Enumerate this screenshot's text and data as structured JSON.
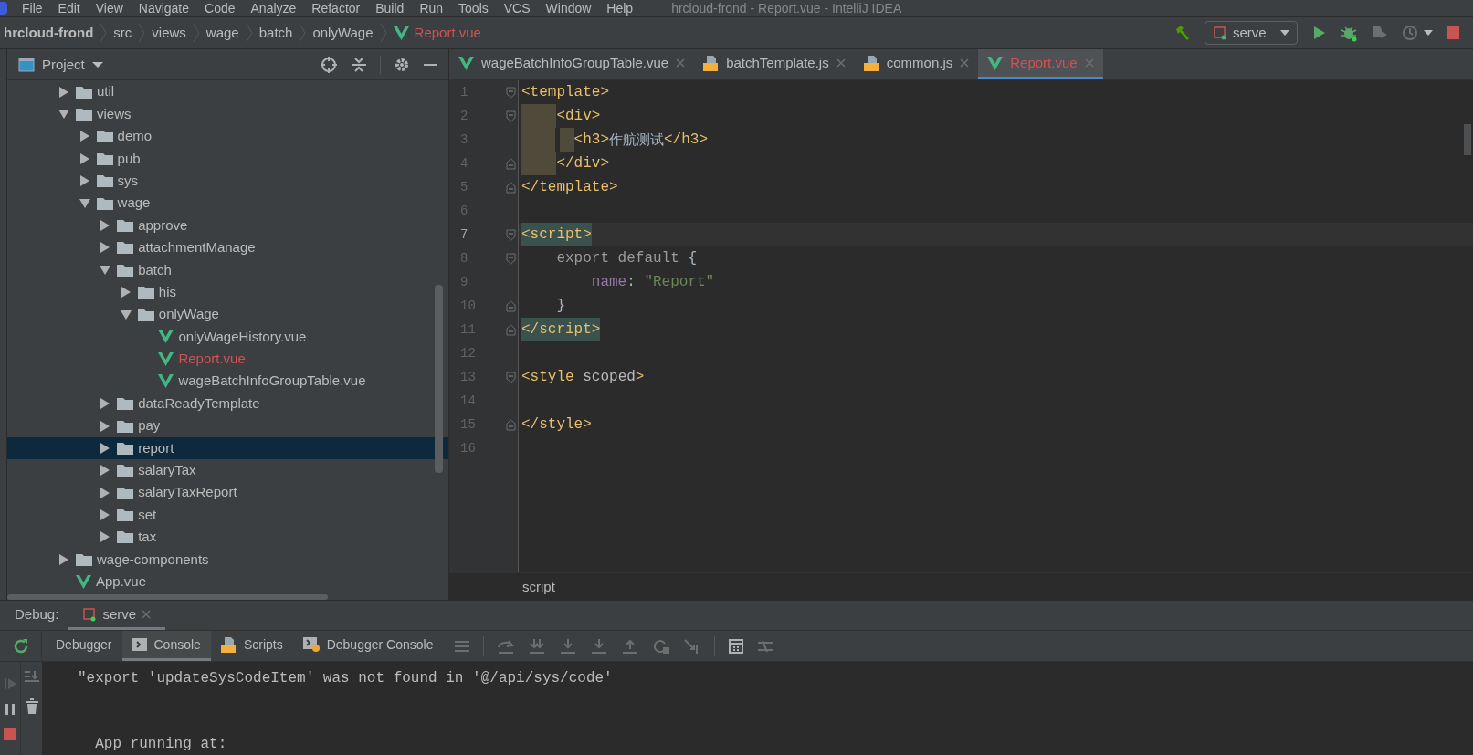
{
  "menu": [
    "File",
    "Edit",
    "View",
    "Navigate",
    "Code",
    "Analyze",
    "Refactor",
    "Build",
    "Run",
    "Tools",
    "VCS",
    "Window",
    "Help"
  ],
  "window": {
    "title": "hrcloud-frond - Report.vue - IntelliJ IDEA"
  },
  "breadcrumbs": [
    {
      "label": "hrcloud-frond",
      "kind": "project"
    },
    {
      "label": "src",
      "kind": "folder"
    },
    {
      "label": "views",
      "kind": "folder"
    },
    {
      "label": "wage",
      "kind": "folder"
    },
    {
      "label": "batch",
      "kind": "folder"
    },
    {
      "label": "onlyWage",
      "kind": "folder"
    },
    {
      "label": "Report.vue",
      "kind": "vue",
      "color": "#d25252"
    }
  ],
  "run_config": {
    "label": "serve"
  },
  "project_panel": {
    "title": "Project"
  },
  "tree": [
    {
      "label": "util",
      "kind": "folder",
      "expanded": false,
      "selected": false
    },
    {
      "label": "views",
      "kind": "folder",
      "expanded": true,
      "selected": false,
      "children": [
        {
          "label": "demo",
          "kind": "folder",
          "expanded": false,
          "selected": false
        },
        {
          "label": "pub",
          "kind": "folder",
          "expanded": false,
          "selected": false
        },
        {
          "label": "sys",
          "kind": "folder",
          "expanded": false,
          "selected": false
        },
        {
          "label": "wage",
          "kind": "folder",
          "expanded": true,
          "selected": false,
          "children": [
            {
              "label": "approve",
              "kind": "folder",
              "expanded": false,
              "selected": false
            },
            {
              "label": "attachmentManage",
              "kind": "folder",
              "expanded": false,
              "selected": false
            },
            {
              "label": "batch",
              "kind": "folder",
              "expanded": true,
              "selected": false,
              "children": [
                {
                  "label": "his",
                  "kind": "folder",
                  "expanded": false,
                  "selected": false
                },
                {
                  "label": "onlyWage",
                  "kind": "folder",
                  "expanded": true,
                  "selected": false,
                  "children": [
                    {
                      "label": "onlyWageHistory.vue",
                      "kind": "vue",
                      "selected": false
                    },
                    {
                      "label": "Report.vue",
                      "kind": "vue",
                      "selected": false,
                      "color": "#d25252"
                    },
                    {
                      "label": "wageBatchInfoGroupTable.vue",
                      "kind": "vue",
                      "selected": false
                    }
                  ]
                }
              ]
            },
            {
              "label": "dataReadyTemplate",
              "kind": "folder",
              "expanded": false,
              "selected": false
            },
            {
              "label": "pay",
              "kind": "folder",
              "expanded": false,
              "selected": false
            },
            {
              "label": "report",
              "kind": "folder",
              "expanded": false,
              "selected": true
            },
            {
              "label": "salaryTax",
              "kind": "folder",
              "expanded": false,
              "selected": false
            },
            {
              "label": "salaryTaxReport",
              "kind": "folder",
              "expanded": false,
              "selected": false
            },
            {
              "label": "set",
              "kind": "folder",
              "expanded": false,
              "selected": false
            },
            {
              "label": "tax",
              "kind": "folder",
              "expanded": false,
              "selected": false
            }
          ]
        }
      ]
    },
    {
      "label": "wage-components",
      "kind": "folder",
      "expanded": false,
      "selected": false
    },
    {
      "label": "App.vue",
      "kind": "vue",
      "selected": false
    }
  ],
  "editor_tabs": [
    {
      "label": "wageBatchInfoGroupTable.vue",
      "kind": "vue",
      "selected": false
    },
    {
      "label": "batchTemplate.js",
      "kind": "js",
      "selected": false
    },
    {
      "label": "common.js",
      "kind": "js",
      "selected": false
    },
    {
      "label": "Report.vue",
      "kind": "vue",
      "selected": true,
      "color": "#d25252"
    }
  ],
  "code_lines": [
    {
      "number": "1",
      "fold_start": true,
      "fold_end": false,
      "tokens": [
        {
          "kind": "tag",
          "text": "<template>"
        }
      ]
    },
    {
      "number": "2",
      "fold_start": true,
      "fold_end": false,
      "indent_guide": true,
      "tokens": [
        {
          "kind": "tag",
          "text": "    <div>"
        }
      ]
    },
    {
      "number": "3",
      "fold_start": false,
      "fold_end": false,
      "indent_guide": true,
      "tokens": [
        {
          "kind": "tag",
          "text": "      <h3>"
        },
        {
          "kind": "text",
          "text": "作航测试"
        },
        {
          "kind": "tag",
          "text": "</h3>"
        }
      ]
    },
    {
      "number": "4",
      "fold_start": false,
      "fold_end": true,
      "indent_guide": true,
      "tokens": [
        {
          "kind": "tag",
          "text": "    </div>"
        }
      ]
    },
    {
      "number": "5",
      "fold_start": false,
      "fold_end": true,
      "tokens": [
        {
          "kind": "tag",
          "text": "</template>"
        }
      ]
    },
    {
      "number": "6",
      "fold_start": false,
      "fold_end": false
    },
    {
      "number": "7",
      "fold_start": true,
      "fold_end": false,
      "current": true,
      "tokens": [
        {
          "kind": "tag-match",
          "text": "<script>"
        }
      ]
    },
    {
      "number": "8",
      "fold_start": true,
      "fold_end": false,
      "tokens": [
        {
          "kind": "keyword",
          "text": "    export default "
        },
        {
          "kind": "text",
          "text": "{"
        }
      ]
    },
    {
      "number": "9",
      "fold_start": false,
      "fold_end": false,
      "tokens": [
        {
          "kind": "property",
          "text": "        name"
        },
        {
          "kind": "text",
          "text": ": "
        },
        {
          "kind": "string",
          "text": "\"Report\""
        }
      ]
    },
    {
      "number": "10",
      "fold_start": false,
      "fold_end": true,
      "tokens": [
        {
          "kind": "text",
          "text": "    }"
        }
      ]
    },
    {
      "number": "11",
      "fold_start": false,
      "fold_end": true,
      "tokens": [
        {
          "kind": "tag-match",
          "text": "</script>"
        }
      ]
    },
    {
      "number": "12",
      "fold_start": false,
      "fold_end": false
    },
    {
      "number": "13",
      "fold_start": true,
      "fold_end": false,
      "tokens": [
        {
          "kind": "tag",
          "text": "<style "
        },
        {
          "kind": "attr",
          "text": "scoped"
        },
        {
          "kind": "tag",
          "text": ">"
        }
      ]
    },
    {
      "number": "14",
      "fold_start": false,
      "fold_end": false
    },
    {
      "number": "15",
      "fold_start": false,
      "fold_end": true,
      "tokens": [
        {
          "kind": "tag",
          "text": "</style>"
        }
      ]
    },
    {
      "number": "16",
      "fold_start": false,
      "fold_end": false
    }
  ],
  "editor_breadcrumb": "script",
  "debug": {
    "label": "Debug:",
    "session": "serve",
    "tabs": [
      {
        "label": "Debugger",
        "kind": "plain",
        "selected": false
      },
      {
        "label": "Console",
        "kind": "console",
        "selected": true
      },
      {
        "label": "Scripts",
        "kind": "js",
        "selected": false
      },
      {
        "label": "Debugger Console",
        "kind": "debugconsole",
        "selected": false
      }
    ],
    "console_lines": [
      "\"export 'updateSysCodeItem' was not found in '@/api/sys/code'",
      "  App running at:"
    ]
  }
}
